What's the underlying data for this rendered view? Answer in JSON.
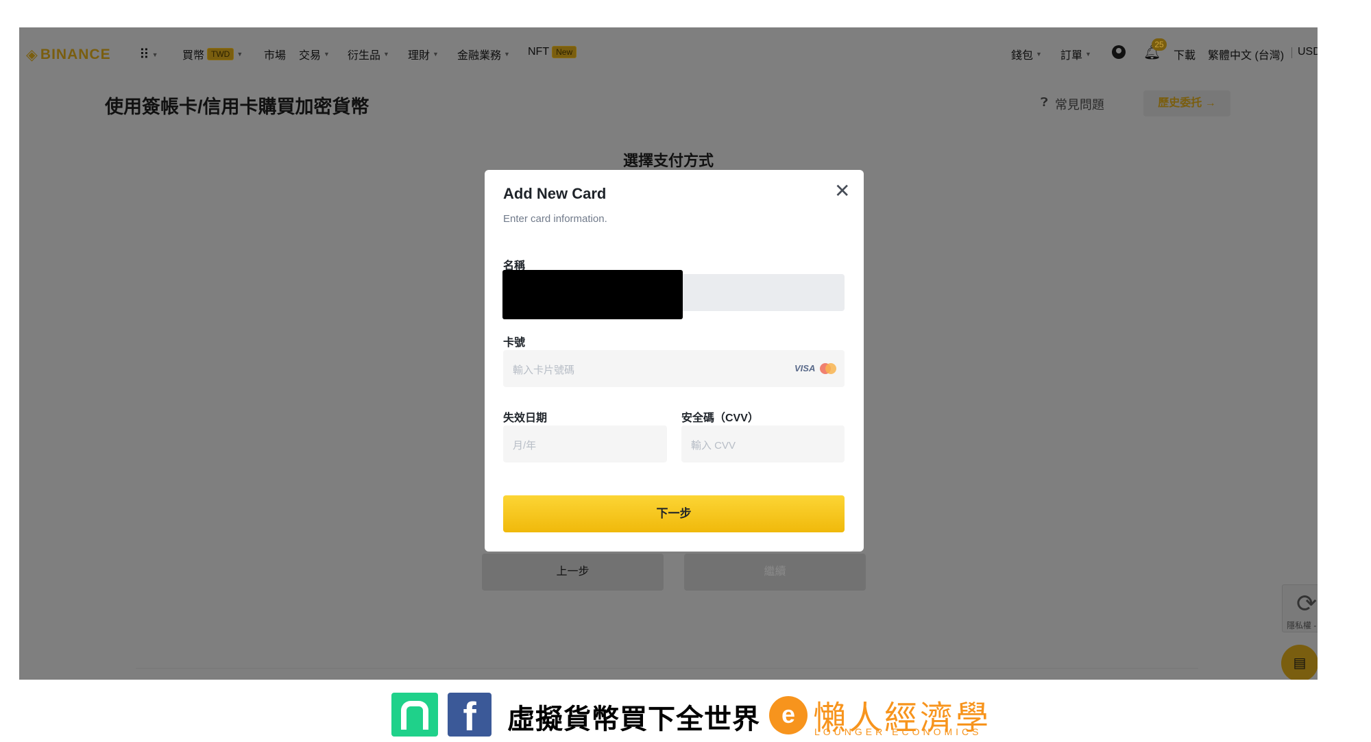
{
  "nav": {
    "logo": "BINANCE",
    "items": [
      {
        "label": "買幣",
        "badge": "TWD"
      },
      {
        "label": "市場"
      },
      {
        "label": "交易"
      },
      {
        "label": "衍生品"
      },
      {
        "label": "理財"
      },
      {
        "label": "金融業務"
      },
      {
        "label": "NFT",
        "badge": "New"
      }
    ],
    "wallet": "錢包",
    "orders": "訂單",
    "notif_count": "25",
    "download": "下載",
    "language": "繁體中文 (台灣)",
    "currency": "USD"
  },
  "page": {
    "title": "使用簽帳卡/信用卡購買加密貨幣",
    "faq": "常見問題",
    "history": "歷史委托",
    "section_title": "選擇支付方式",
    "back": "上一步",
    "continue": "繼續"
  },
  "modal": {
    "title": "Add New Card",
    "subtitle": "Enter card information.",
    "name_label": "名稱",
    "card_label": "卡號",
    "card_placeholder": "輸入卡片號碼",
    "visa": "VISA",
    "expiry_label": "失效日期",
    "expiry_placeholder": "月/年",
    "cvv_label": "安全碼（CVV）",
    "cvv_placeholder": "輸入 CVV",
    "next": "下一步"
  },
  "recaptcha": {
    "text": "隱私權 - 條款"
  },
  "footer": {
    "slogan": "虛擬貨幣買下全世界",
    "brand": "懶人經濟學",
    "brand_en": "LOUNGER ECONOMICS"
  },
  "colors": {
    "accent": "#f0b90b",
    "overlay": "#7f7f7f",
    "brand_orange": "#f7941d",
    "line_green": "#1fd18a",
    "facebook": "#3b5998"
  }
}
